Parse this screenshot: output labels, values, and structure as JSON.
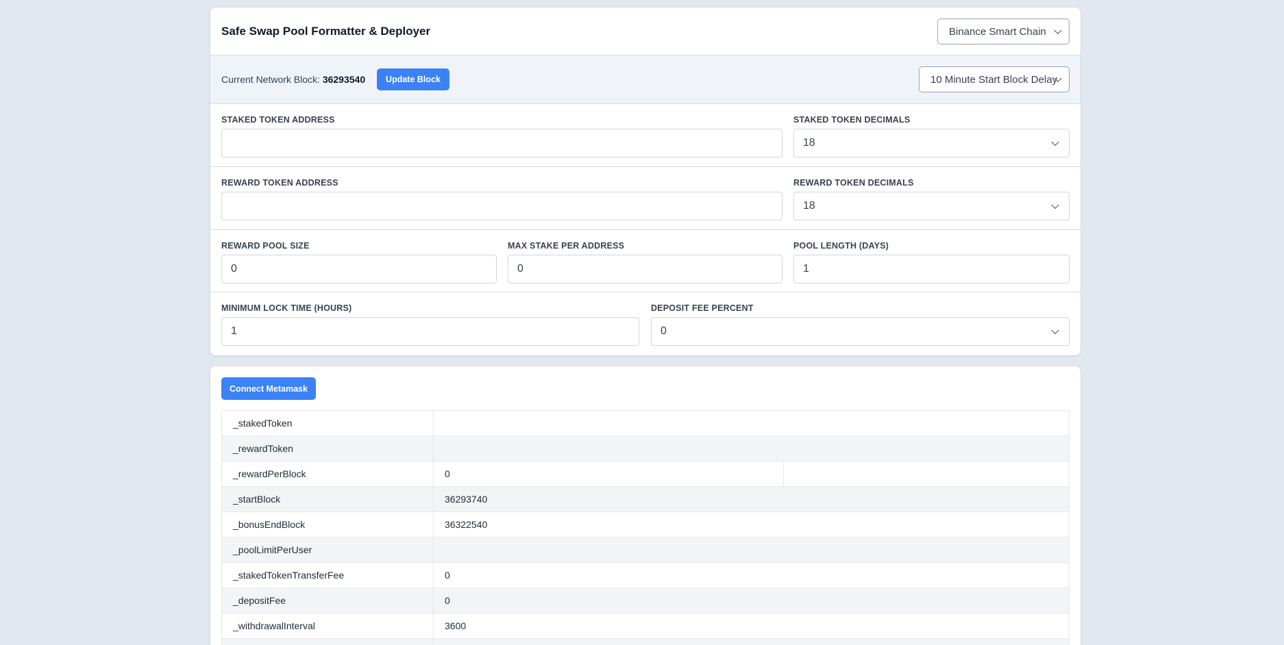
{
  "header": {
    "title": "Safe Swap Pool Formatter & Deployer",
    "network": "Binance Smart Chain"
  },
  "block": {
    "label": "Current Network Block:",
    "value": "36293540",
    "update_button": "Update Block",
    "delay": "10 Minute Start Block Delay"
  },
  "fields": {
    "staked_token_address": {
      "label": "STAKED TOKEN ADDRESS",
      "value": ""
    },
    "staked_token_decimals": {
      "label": "STAKED TOKEN DECIMALS",
      "value": "18"
    },
    "reward_token_address": {
      "label": "REWARD TOKEN ADDRESS",
      "value": ""
    },
    "reward_token_decimals": {
      "label": "REWARD TOKEN DECIMALS",
      "value": "18"
    },
    "reward_pool_size": {
      "label": "REWARD POOL SIZE",
      "value": "0"
    },
    "max_stake_per_address": {
      "label": "MAX STAKE PER ADDRESS",
      "value": "0"
    },
    "pool_length_days": {
      "label": "POOL LENGTH (DAYS)",
      "value": "1"
    },
    "minimum_lock_time": {
      "label": "MINIMUM LOCK TIME (HOURS)",
      "value": "1"
    },
    "deposit_fee_percent": {
      "label": "DEPOSIT FEE PERCENT",
      "value": "0"
    }
  },
  "deploy": {
    "connect_button": "Connect Metamask",
    "params": [
      {
        "key": "_stakedToken",
        "value": ""
      },
      {
        "key": "_rewardToken",
        "value": ""
      },
      {
        "key": "_rewardPerBlock",
        "value": "0",
        "extra": ""
      },
      {
        "key": "_startBlock",
        "value": "36293740"
      },
      {
        "key": "_bonusEndBlock",
        "value": "36322540"
      },
      {
        "key": "_poolLimitPerUser",
        "value": ""
      },
      {
        "key": "_stakedTokenTransferFee",
        "value": "0"
      },
      {
        "key": "_depositFee",
        "value": "0"
      },
      {
        "key": "_withdrawalInterval",
        "value": "3600"
      }
    ]
  },
  "colors": {
    "accent": "#3b82f6",
    "page_bg": "#e2e8f0",
    "band_bg": "#f0f4f8"
  }
}
